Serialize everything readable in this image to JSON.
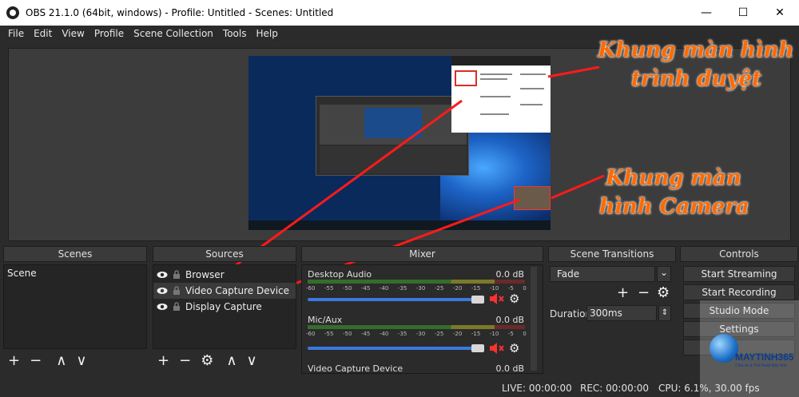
{
  "window": {
    "title": "OBS 21.1.0 (64bit, windows) - Profile: Untitled - Scenes: Untitled",
    "minimize_glyph": "—",
    "maximize_glyph": "☐",
    "close_glyph": "✕"
  },
  "menu": [
    "File",
    "Edit",
    "View",
    "Profile",
    "Scene Collection",
    "Tools",
    "Help"
  ],
  "annotations": {
    "browser_line1": "Khung màn hình",
    "browser_line2": "trình duyệt",
    "camera_line1": "Khung màn",
    "camera_line2": "hình Camera",
    "color": "#ff6a00",
    "arrow_color": "#ff1a1a"
  },
  "docks": {
    "scenes": {
      "title": "Scenes",
      "items": [
        "Scene"
      ]
    },
    "sources": {
      "title": "Sources",
      "items": [
        "Browser",
        "Video Capture Device",
        "Display Capture"
      ]
    },
    "mixer": {
      "title": "Mixer",
      "channels": [
        {
          "name": "Desktop Audio",
          "db": "0.0 dB"
        },
        {
          "name": "Mic/Aux",
          "db": "0.0 dB"
        },
        {
          "name": "Video Capture Device",
          "db": "0.0 dB"
        }
      ],
      "scale": [
        "-60",
        "-55",
        "-50",
        "-45",
        "-40",
        "-35",
        "-30",
        "-25",
        "-20",
        "-15",
        "-10",
        "-5",
        "0"
      ]
    },
    "transitions": {
      "title": "Scene Transitions",
      "selected": "Fade",
      "duration_label": "Duration",
      "duration_value": "300ms"
    },
    "controls": {
      "title": "Controls",
      "buttons": [
        "Start Streaming",
        "Start Recording",
        "Studio Mode",
        "Settings",
        "",
        ""
      ]
    }
  },
  "status": {
    "live": "LIVE: 00:00:00",
    "rec": "REC: 00:00:00",
    "cpu": "CPU: 6.1%, 30.00 fps"
  },
  "logo": {
    "name": "MAYTINH365",
    "tagline": "Chia sẻ & Thủ thuật Máy tính"
  },
  "icons": {
    "add": "+",
    "remove": "−",
    "up": "∧",
    "down": "∨",
    "gear": "⚙",
    "mute": "🔇",
    "dropdown": "⌄",
    "spin": "⇕"
  }
}
